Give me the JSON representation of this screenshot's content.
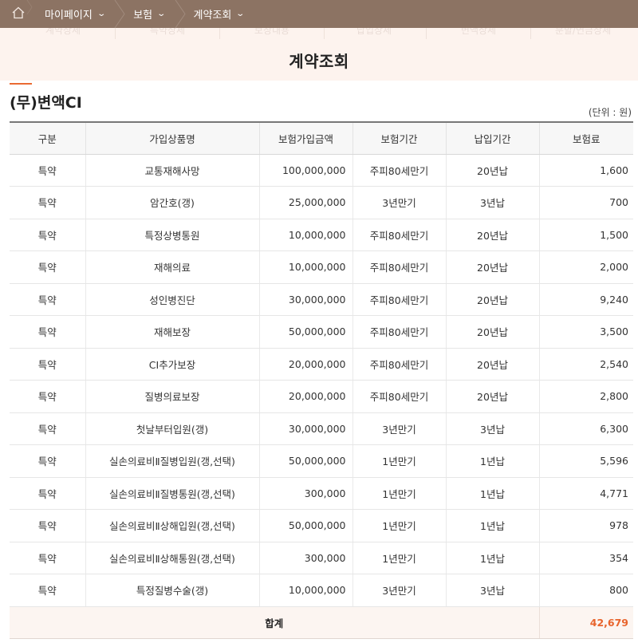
{
  "breadcrumb": {
    "items": [
      {
        "label": "마이페이지"
      },
      {
        "label": "보험"
      },
      {
        "label": "계약조회"
      }
    ]
  },
  "subtabs": [
    "계약상세",
    "특약상세",
    "보장내용",
    "납입상세",
    "변액상세",
    "분할/연금상세"
  ],
  "page": {
    "title": "계약조회",
    "product_name": "(무)변액CI",
    "unit_note": "(단위 : 원)"
  },
  "table": {
    "headers": [
      "구분",
      "가입상품명",
      "보험가입금액",
      "보험기간",
      "납입기간",
      "보험료"
    ],
    "rows": [
      [
        "특약",
        "교통재해사망",
        "100,000,000",
        "주피80세만기",
        "20년납",
        "1,600"
      ],
      [
        "특약",
        "암간호(갱)",
        "25,000,000",
        "3년만기",
        "3년납",
        "700"
      ],
      [
        "특약",
        "특정상병통원",
        "10,000,000",
        "주피80세만기",
        "20년납",
        "1,500"
      ],
      [
        "특약",
        "재해의료",
        "10,000,000",
        "주피80세만기",
        "20년납",
        "2,000"
      ],
      [
        "특약",
        "성인병진단",
        "30,000,000",
        "주피80세만기",
        "20년납",
        "9,240"
      ],
      [
        "특약",
        "재해보장",
        "50,000,000",
        "주피80세만기",
        "20년납",
        "3,500"
      ],
      [
        "특약",
        "CI추가보장",
        "20,000,000",
        "주피80세만기",
        "20년납",
        "2,540"
      ],
      [
        "특약",
        "질병의료보장",
        "20,000,000",
        "주피80세만기",
        "20년납",
        "2,800"
      ],
      [
        "특약",
        "첫날부터입원(갱)",
        "30,000,000",
        "3년만기",
        "3년납",
        "6,300"
      ],
      [
        "특약",
        "실손의료비Ⅱ질병입원(갱,선택)",
        "50,000,000",
        "1년만기",
        "1년납",
        "5,596"
      ],
      [
        "특약",
        "실손의료비Ⅱ질병통원(갱,선택)",
        "300,000",
        "1년만기",
        "1년납",
        "4,771"
      ],
      [
        "특약",
        "실손의료비Ⅱ상해입원(갱,선택)",
        "50,000,000",
        "1년만기",
        "1년납",
        "978"
      ],
      [
        "특약",
        "실손의료비Ⅱ상해통원(갱,선택)",
        "300,000",
        "1년만기",
        "1년납",
        "354"
      ],
      [
        "특약",
        "특정질병수술(갱)",
        "10,000,000",
        "3년만기",
        "3년납",
        "800"
      ]
    ],
    "total_label": "합계",
    "total_value": "42,679"
  },
  "colors": {
    "breadcrumb_bg": "#8c7363",
    "title_band_bg": "#fdf3ee",
    "accent": "#ea6a32",
    "total_value": "#e8642c"
  },
  "icons": {
    "home": "home-icon",
    "dropdown": "chevron-down-icon"
  }
}
